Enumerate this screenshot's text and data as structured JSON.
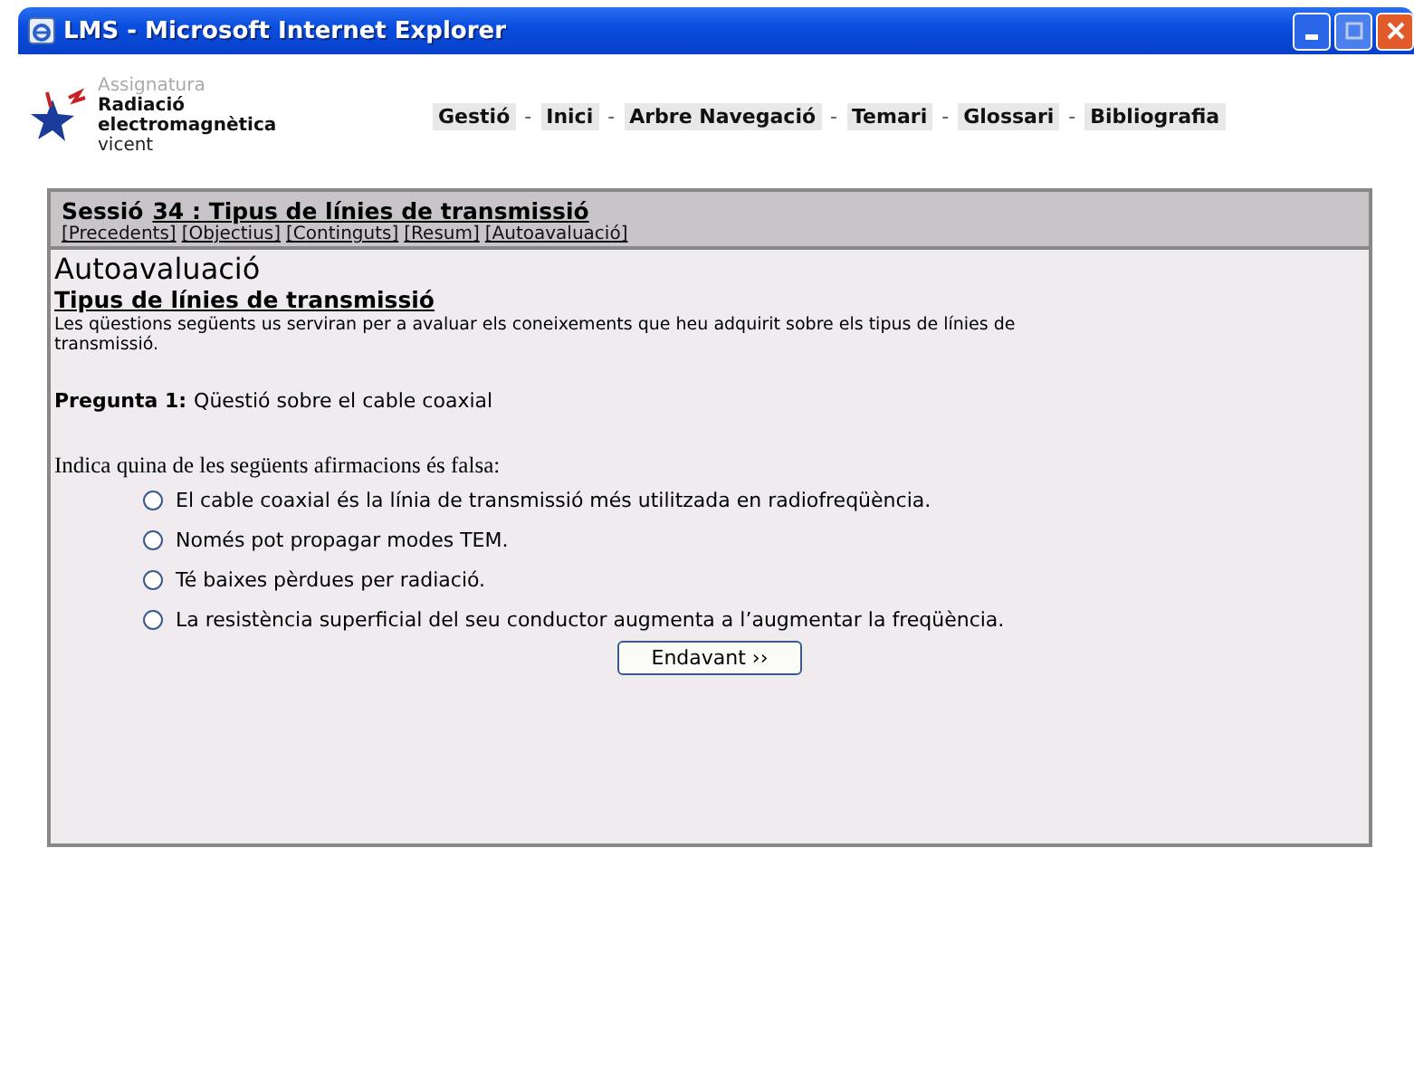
{
  "window": {
    "title": "LMS - Microsoft Internet Explorer"
  },
  "course": {
    "caption": "Assignatura",
    "name_line1": "Radiació",
    "name_line2": "electromagnètica",
    "user": "vicent"
  },
  "nav": [
    "Gestió",
    "Inici",
    "Arbre Navegació",
    "Temari",
    "Glossari",
    "Bibliografia"
  ],
  "nav_separator": "-",
  "session": {
    "prefix": "Sessió",
    "link": "34 : Tipus de línies de transmissió",
    "links": [
      "[Precedents]",
      "[Objectius]",
      "[Continguts]",
      "[Resum]",
      "[Autoavaluació]"
    ]
  },
  "content": {
    "heading": "Autoavaluació",
    "subheading": "Tipus de línies de transmissió",
    "intro": "Les qüestions següents us serviran per a avaluar els coneixements que heu adquirit sobre els tipus de línies de transmissió.",
    "question_label": "Pregunta 1:",
    "question_title": "Qüestió sobre el cable coaxial",
    "prompt": "Indica quina de les següents afirmacions és falsa:",
    "options": [
      {
        "label": "El cable coaxial és la línia de transmissió més utilitzada en radiofreqüència.",
        "selected": false
      },
      {
        "label": "Només pot propagar modes TEM.",
        "selected": false
      },
      {
        "label": "Té baixes pèrdues per radiació.",
        "selected": false
      },
      {
        "label": "La resistència superficial del seu conductor augmenta a l’augmentar la freqüència.",
        "selected": false
      }
    ],
    "next_button": "Endavant ››"
  }
}
